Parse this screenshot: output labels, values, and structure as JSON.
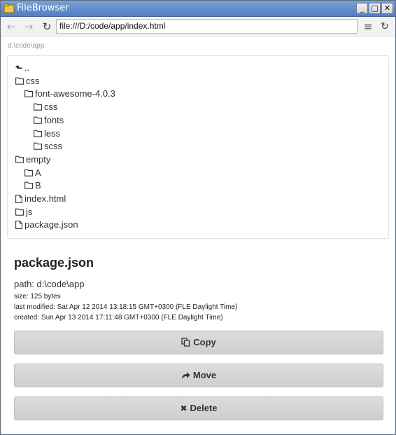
{
  "window": {
    "title": "FileBrowser",
    "minimize_label": "_",
    "maximize_label": "□",
    "close_label": "✕"
  },
  "toolbar": {
    "url": "file:///D:/code/app/index.html"
  },
  "breadcrumb": "d:\\code\\app",
  "tree": [
    {
      "label": "..",
      "type": "up",
      "depth": 0
    },
    {
      "label": "css",
      "type": "folder",
      "depth": 0
    },
    {
      "label": "font-awesome-4.0.3",
      "type": "folder",
      "depth": 1
    },
    {
      "label": "css",
      "type": "folder",
      "depth": 2
    },
    {
      "label": "fonts",
      "type": "folder",
      "depth": 2
    },
    {
      "label": "less",
      "type": "folder",
      "depth": 2
    },
    {
      "label": "scss",
      "type": "folder",
      "depth": 2
    },
    {
      "label": "empty",
      "type": "folder",
      "depth": 0
    },
    {
      "label": "A",
      "type": "folder",
      "depth": 1
    },
    {
      "label": "B",
      "type": "folder",
      "depth": 1
    },
    {
      "label": "index.html",
      "type": "file",
      "depth": 0
    },
    {
      "label": "js",
      "type": "folder",
      "depth": 0
    },
    {
      "label": "package.json",
      "type": "file",
      "depth": 0
    }
  ],
  "details": {
    "name": "package.json",
    "path": "path: d:\\code\\app",
    "size": "size: 125 bytes",
    "modified": "last modified: Sat Apr 12 2014 13:18:15 GMT+0300 (FLE Daylight Time)",
    "created": "created: Sun Apr 13 2014 17:11:48 GMT+0300 (FLE Daylight Time)"
  },
  "actions": {
    "copy": "Copy",
    "move": "Move",
    "delete": "Delete"
  }
}
